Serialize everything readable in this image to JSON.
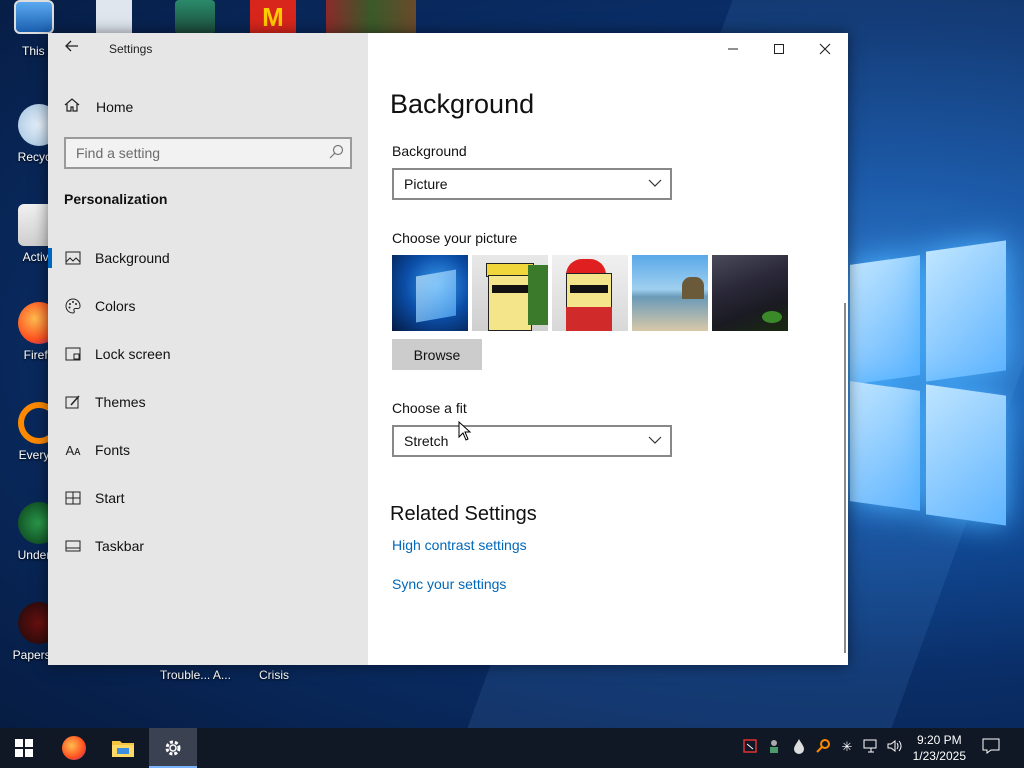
{
  "desktop": {
    "icons": [
      {
        "label": "This P"
      },
      {
        "label": "Recycle"
      },
      {
        "label": "Activa"
      },
      {
        "label": "Firefo"
      },
      {
        "label": "Everyth"
      },
      {
        "label": "Underta"
      },
      {
        "label": "Papers, P"
      }
    ],
    "bottom_labels": [
      "Trouble... A...",
      "Crisis"
    ]
  },
  "window": {
    "title": "Settings",
    "back_icon": "back-arrow-icon",
    "minimize_icon": "minimize-icon",
    "maximize_icon": "maximize-icon",
    "close_icon": "close-icon"
  },
  "sidebar": {
    "home_label": "Home",
    "search_placeholder": "Find a setting",
    "section_title": "Personalization",
    "items": [
      {
        "label": "Background",
        "icon": "picture-icon",
        "active": true
      },
      {
        "label": "Colors",
        "icon": "palette-icon",
        "active": false
      },
      {
        "label": "Lock screen",
        "icon": "lock-screen-icon",
        "active": false
      },
      {
        "label": "Themes",
        "icon": "brush-icon",
        "active": false
      },
      {
        "label": "Fonts",
        "icon": "font-icon",
        "active": false
      },
      {
        "label": "Start",
        "icon": "start-grid-icon",
        "active": false
      },
      {
        "label": "Taskbar",
        "icon": "taskbar-icon",
        "active": false
      }
    ]
  },
  "main": {
    "page_title": "Background",
    "background_label": "Background",
    "background_value": "Picture",
    "choose_picture_label": "Choose your picture",
    "browse_label": "Browse",
    "choose_fit_label": "Choose a fit",
    "fit_value": "Stretch",
    "related_title": "Related Settings",
    "links": [
      "High contrast settings",
      "Sync your settings"
    ]
  },
  "taskbar": {
    "pinned": [
      "start-icon",
      "firefox-icon",
      "file-explorer-icon",
      "settings-icon"
    ],
    "time": "9:20 PM",
    "date": "1/23/2025"
  },
  "colors": {
    "accent": "#0067c0",
    "link": "#0067b8",
    "sidebar_bg": "#e6e6e6",
    "taskbar_bg": "#101725"
  }
}
